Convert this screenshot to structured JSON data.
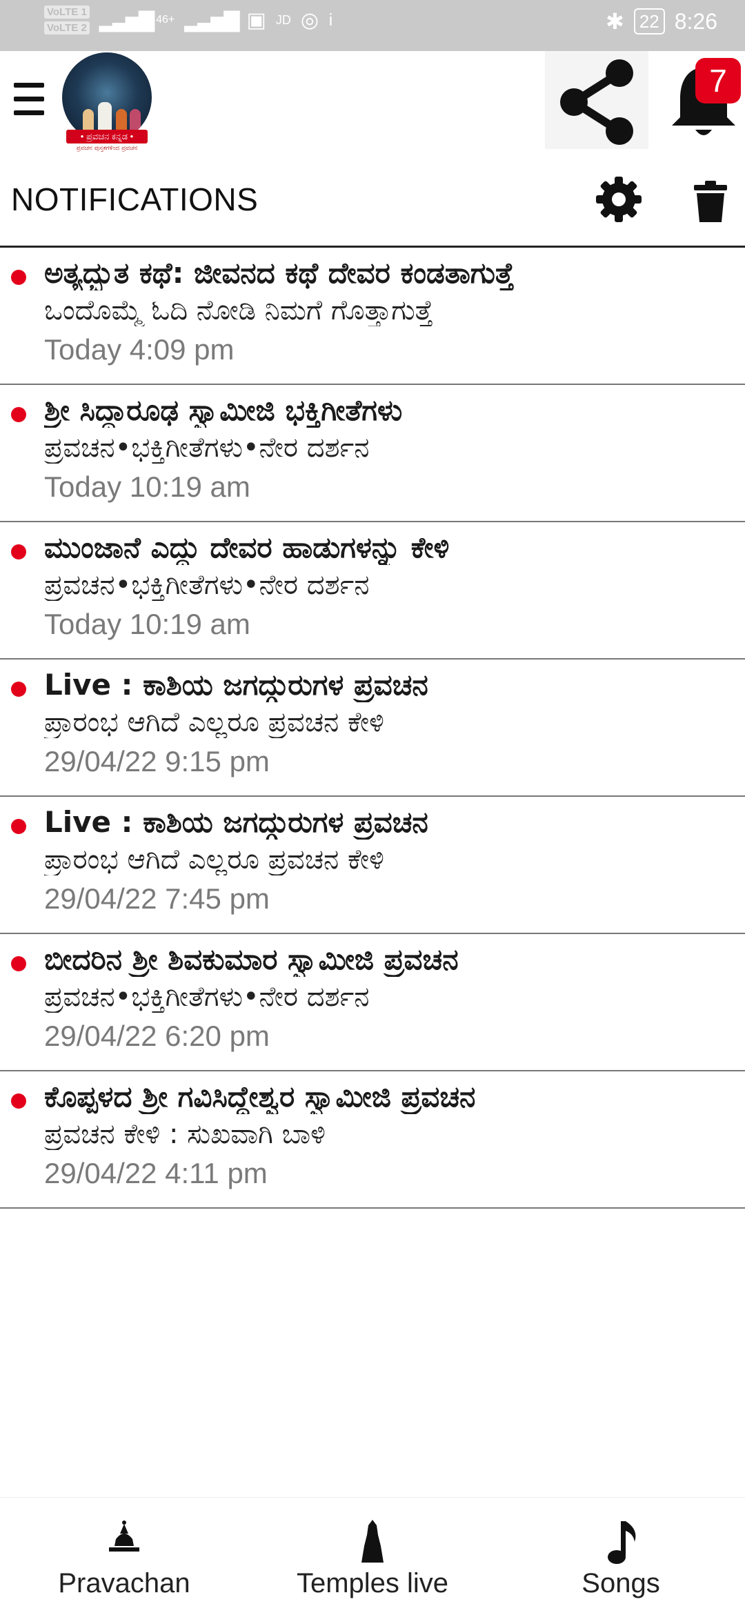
{
  "status_bar": {
    "volte_1": "VoLTE 1",
    "volte_2": "VoLTE 2",
    "signal": "46+",
    "app_indicator": "JD",
    "battery": "22",
    "time": "8:26"
  },
  "header": {
    "logo_banner": "• ಪ್ರವಚನ ಕನ್ನಡ •",
    "logo_tagline": "ಪ್ರವಚನ ಪುಸ್ತಕಗಳಿಂದ ಪ್ರವಚನ",
    "notification_count": "7",
    "icons": [
      "menu-icon",
      "share-icon",
      "bell-icon"
    ]
  },
  "page": {
    "title": "NOTIFICATIONS",
    "icons": [
      "gear-icon",
      "trash-icon"
    ]
  },
  "notifications": [
    {
      "title": "ಅತ್ಯದ್ಭುತ ಕಥೆ: ಜೀವನದ ಕಥೆ ದೇವರ ಕಂಡತಾಗುತ್ತೆ",
      "body": "ಒಂದೊಮ್ಮೆ ಓದಿ ನೋಡಿ ನಿಮಗೆ ಗೊತ್ತಾಗುತ್ತೆ",
      "time": "Today 4:09 pm"
    },
    {
      "title": "ಶ್ರೀ ಸಿದ್ಧಾರೂಢ ಸ್ವಾಮೀಜಿ ಭಕ್ತಿಗೀತೆಗಳು",
      "body": "ಪ್ರವಚನ•ಭಕ್ತಿಗೀತೆಗಳು•ನೇರ ದರ್ಶನ",
      "time": "Today 10:19 am"
    },
    {
      "title": "ಮುಂಜಾನೆ ಎದ್ದು ದೇವರ ಹಾಡುಗಳನ್ನು ಕೇಳಿ",
      "body": "ಪ್ರವಚನ•ಭಕ್ತಿಗೀತೆಗಳು•ನೇರ ದರ್ಶನ",
      "time": "Today 10:19 am"
    },
    {
      "title": "Live : ಕಾಶಿಯ ಜಗದ್ಗುರುಗಳ ಪ್ರವಚನ",
      "body": "ಪ್ರಾರಂಭ ಆಗಿದೆ ಎಲ್ಲರೂ ಪ್ರವಚನ ಕೇಳಿ",
      "time": "29/04/22 9:15 pm"
    },
    {
      "title": "Live : ಕಾಶಿಯ ಜಗದ್ಗುರುಗಳ ಪ್ರವಚನ",
      "body": "ಪ್ರಾರಂಭ ಆಗಿದೆ ಎಲ್ಲರೂ ಪ್ರವಚನ ಕೇಳಿ",
      "time": "29/04/22 7:45 pm"
    },
    {
      "title": "ಬೀದರಿನ ಶ್ರೀ ಶಿವಕುಮಾರ ಸ್ವಾಮೀಜಿ ಪ್ರವಚನ",
      "body": "ಪ್ರವಚನ•ಭಕ್ತಿಗೀತೆಗಳು•ನೇರ ದರ್ಶನ",
      "time": "29/04/22 6:20 pm"
    },
    {
      "title": "ಕೊಪ್ಪಳದ ಶ್ರೀ ಗವಿಸಿದ್ದೇಶ್ವರ ಸ್ವಾಮೀಜಿ ಪ್ರವಚನ",
      "body": "ಪ್ರವಚನ ಕೇಳಿ : ಸುಖವಾಗಿ ಬಾಳಿ",
      "time": "29/04/22 4:11 pm"
    }
  ],
  "bottom_nav": [
    {
      "label": "Pravachan",
      "icon": "temple-icon"
    },
    {
      "label": "Temples live",
      "icon": "gopuram-icon"
    },
    {
      "label": "Songs",
      "icon": "music-note-icon"
    }
  ],
  "colors": {
    "accent_red": "#e3001b",
    "status_bar": "#c9c9c9",
    "timestamp": "#7a7a7a"
  }
}
